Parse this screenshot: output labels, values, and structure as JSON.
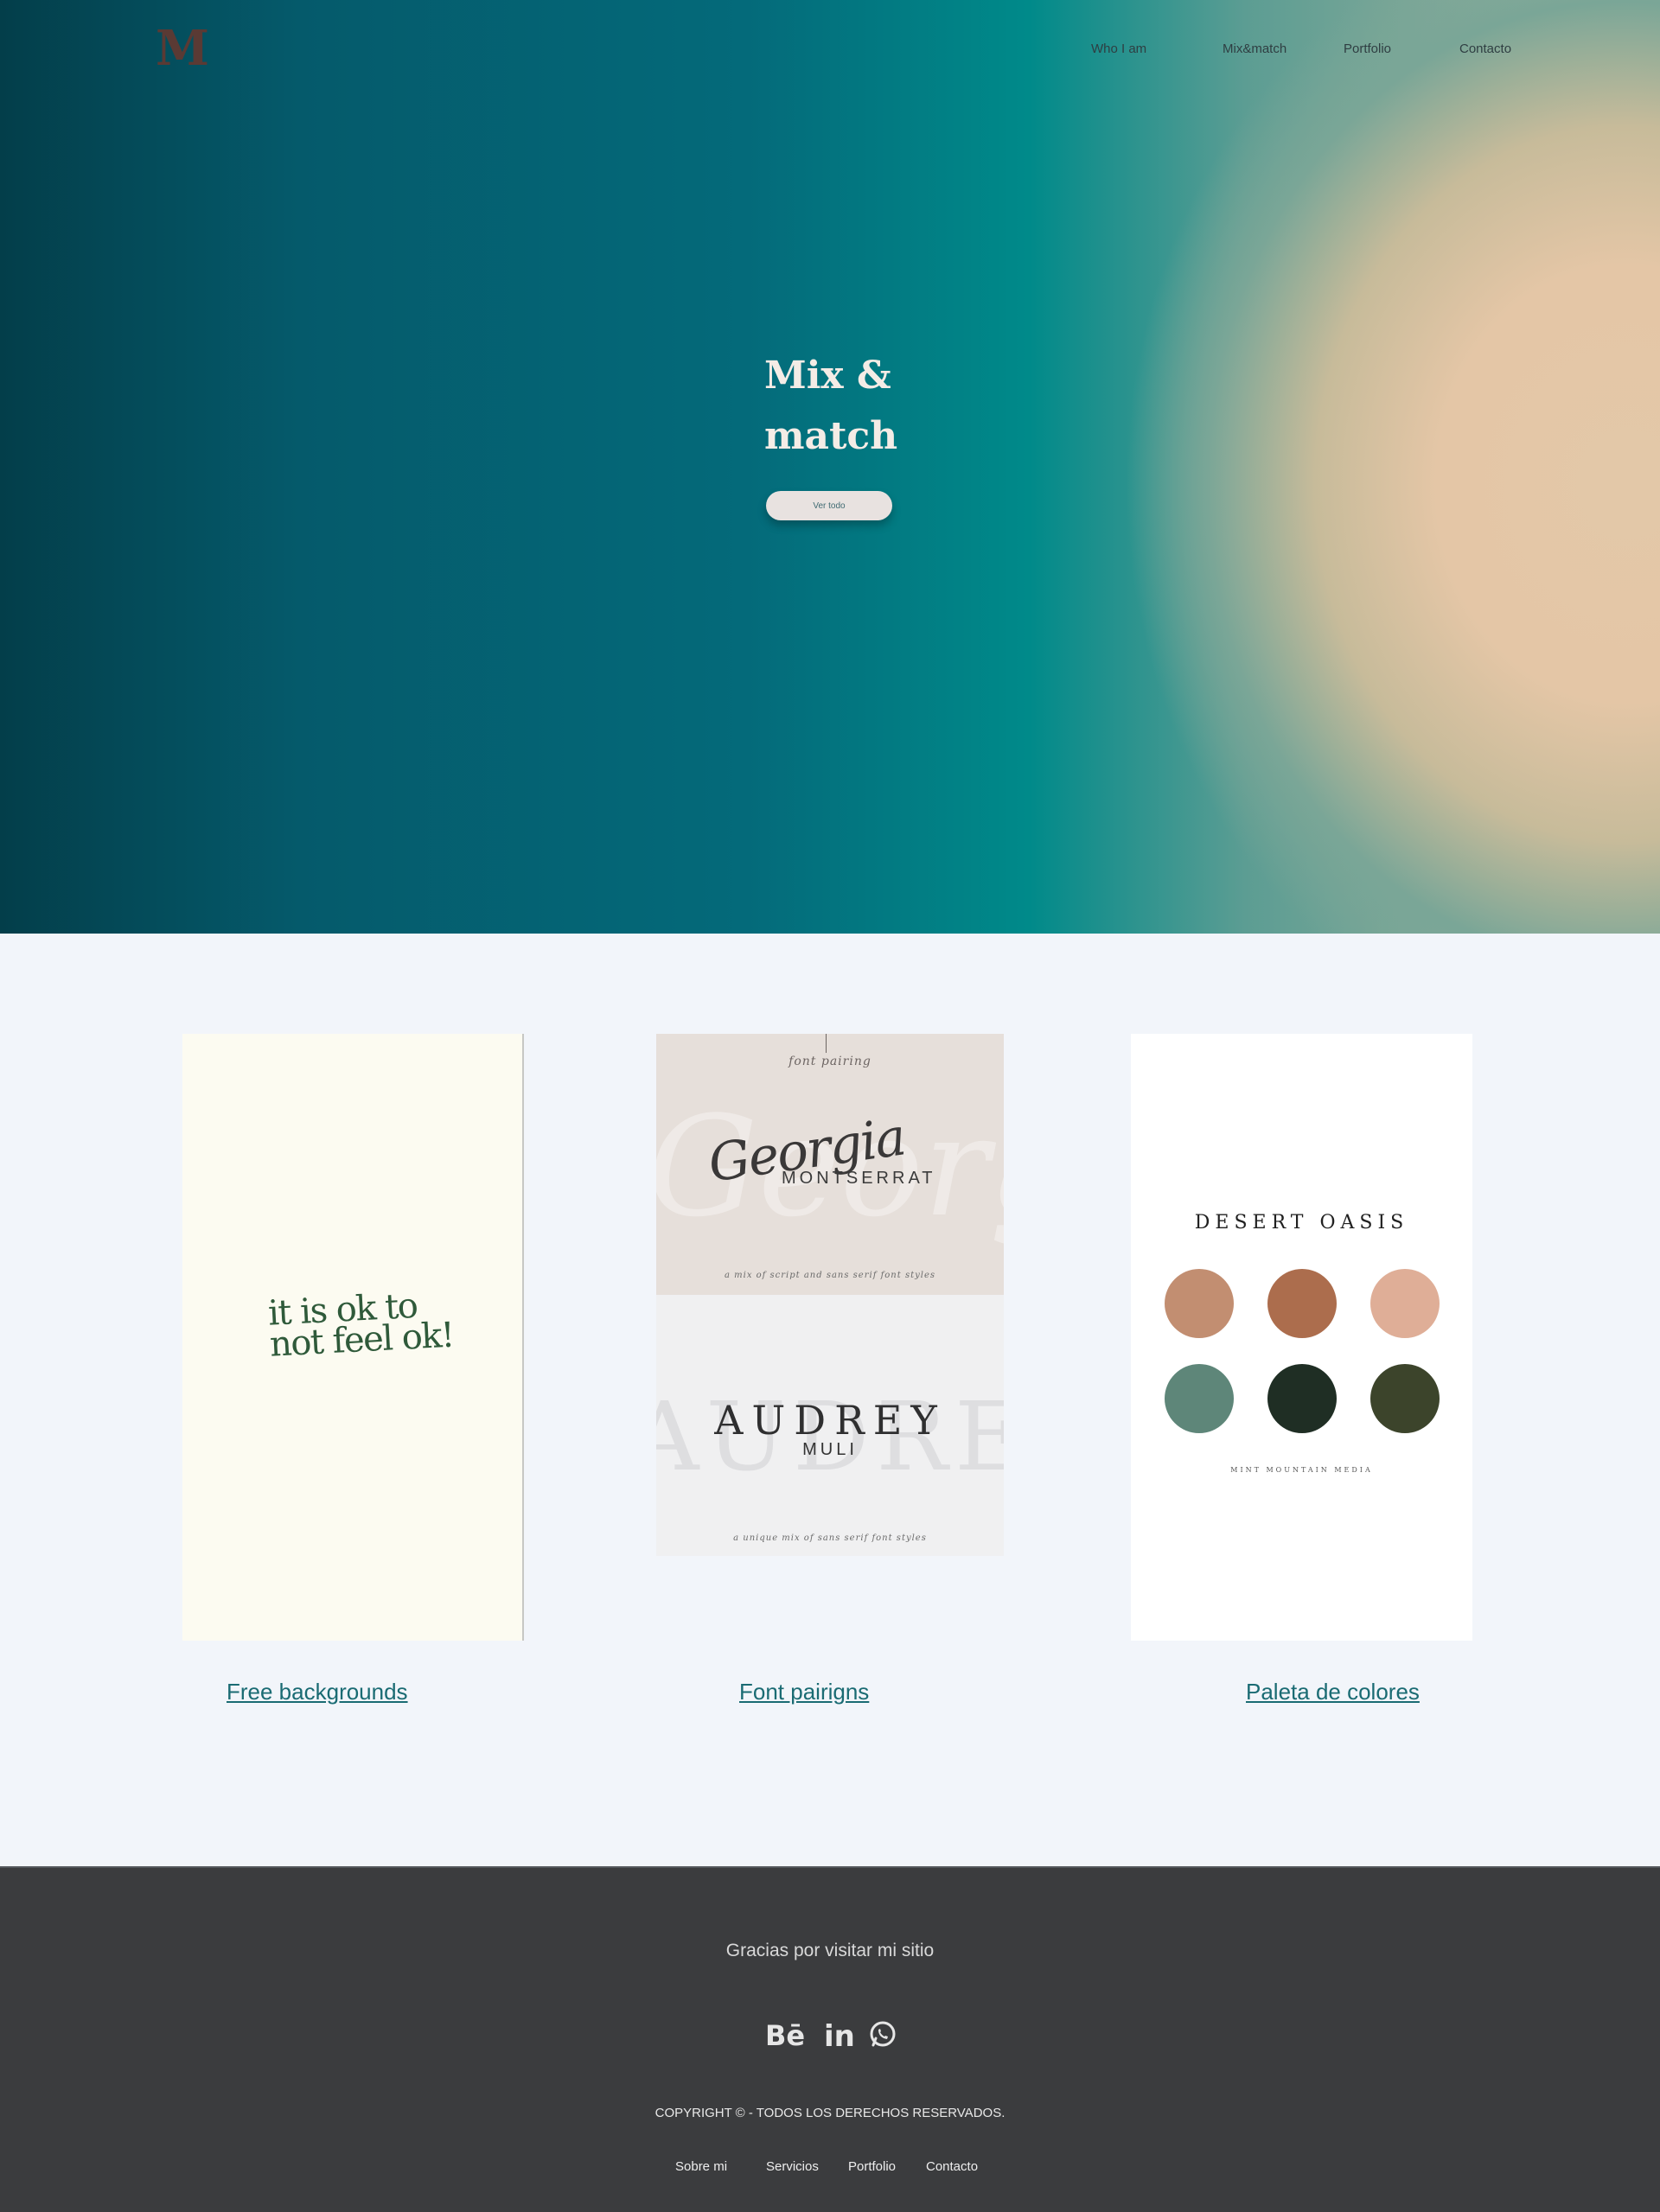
{
  "header": {
    "logo_text": "M",
    "nav": [
      {
        "label": "Who I am"
      },
      {
        "label": "Mix&match"
      },
      {
        "label": "Portfolio"
      },
      {
        "label": "Contacto"
      }
    ]
  },
  "hero": {
    "title_line1": "Mix &",
    "title_line2": "match",
    "button_label": "Ver todo"
  },
  "cards": [
    {
      "label": "Free backgrounds",
      "image_text_line1": "it is ok to",
      "image_text_line2": "not feel ok!"
    },
    {
      "label": "Font pairigns",
      "top_heading": "font pairing",
      "top_script": "Georgia",
      "top_sans": "MONTSERRAT",
      "top_caption": "a mix of script and sans serif font styles",
      "bottom_ghost": "AUDREY",
      "bottom_serif": "AUDREY",
      "bottom_sans": "MULI",
      "bottom_caption": "a unique mix of sans serif font styles"
    },
    {
      "label": "Paleta de colores",
      "palette_title": "DESERT OASIS",
      "palette_footer": "MINT MOUNTAIN MEDIA",
      "swatches": [
        "#c28e71",
        "#ac6d4d",
        "#dfae97",
        "#5e8679",
        "#1f2e24",
        "#3c442b"
      ]
    }
  ],
  "footer": {
    "thanks": "Gracias por visitar mi sitio",
    "social_icons": [
      "behance-icon",
      "linkedin-icon",
      "whatsapp-icon"
    ],
    "copyright": "COPYRIGHT ©  - TODOS LOS DERECHOS RESERVADOS.",
    "links": [
      {
        "label": "Sobre mi"
      },
      {
        "label": "Servicios"
      },
      {
        "label": "Portfolio"
      },
      {
        "label": "Contacto"
      }
    ]
  },
  "colors": {
    "accent": "#1a6b73",
    "footer_bg": "#3b3c3e",
    "page_bg": "#f2f5fa"
  }
}
